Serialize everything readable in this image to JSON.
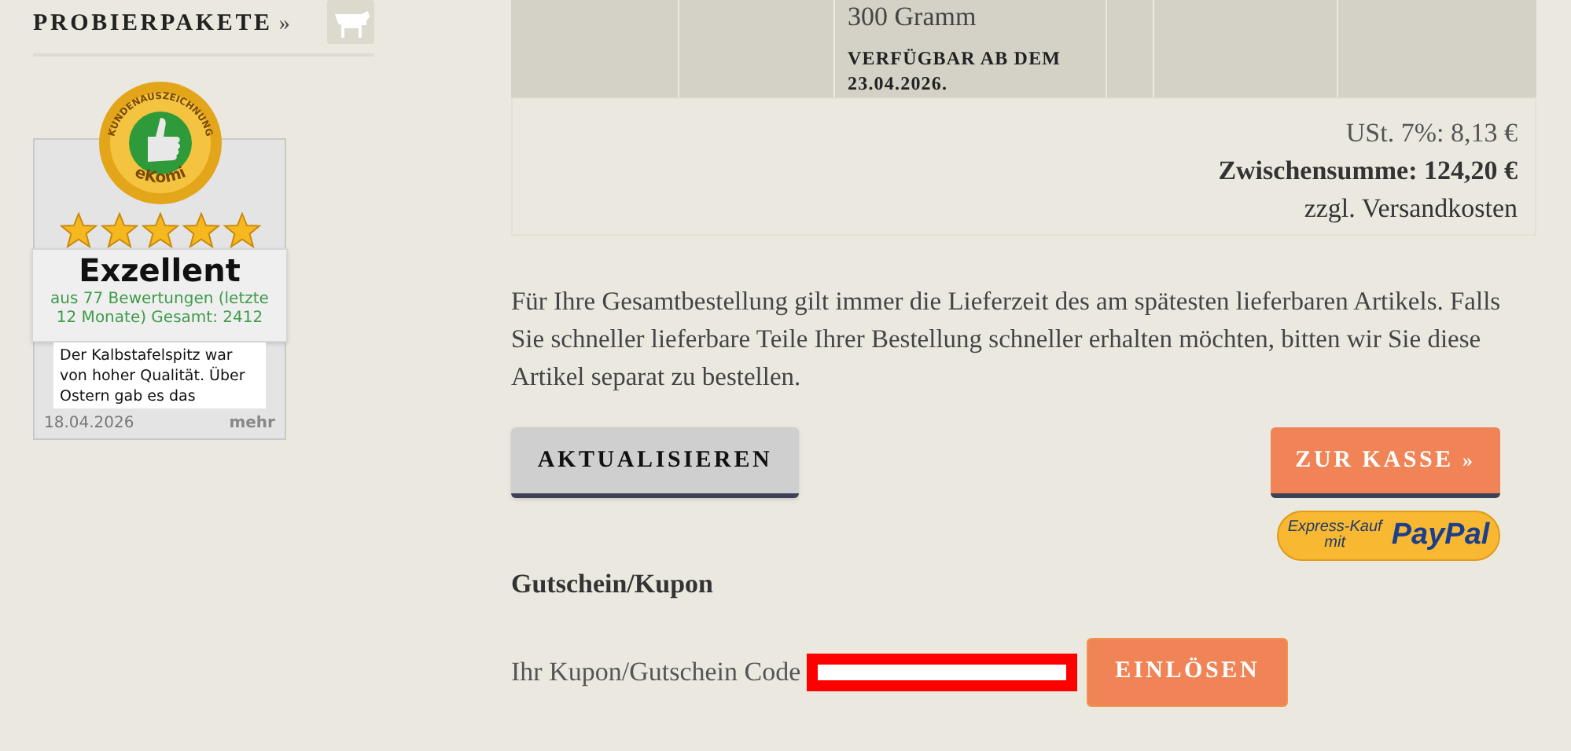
{
  "sidebar": {
    "title": "PROBIERPAKETE",
    "title_suffix": "»",
    "review_widget": {
      "seal_top": "KUNDENAUSZEICHNUNG",
      "seal_bottom": "eKomi",
      "stars": 5,
      "rating": "Exzellent",
      "summary": "aus 77 Bewertungen (letzte 12 Monate) Gesamt: 2412",
      "review": "Der Kalbstafelspitz war von hoher Qualität. Über Ostern gab es das",
      "date": "18.04.2026",
      "more": "mehr"
    }
  },
  "cart_row": {
    "cells": [
      {
        "kind": "empty"
      },
      {
        "kind": "empty"
      },
      {
        "kind": "product",
        "amount": "300 Gramm",
        "availability": "VERFÜGBAR AB DEM 23.04.2026."
      },
      {
        "kind": "empty"
      },
      {
        "kind": "empty"
      },
      {
        "kind": "empty"
      }
    ]
  },
  "totals": {
    "tax": "USt. 7%: 8,13 €",
    "subtotal": "Zwischensumme: 124,20 €",
    "shipping": "zzgl. Versandkosten"
  },
  "delivery_note": "Für Ihre Gesamtbestellung gilt immer die Lieferzeit des am spätesten lieferbaren Artikels. Falls Sie schneller lieferbare Teile Ihrer Bestellung schneller erhalten möchten, bitten wir Sie diese Artikel separat zu bestellen.",
  "update_button": "AKTUALISIEREN",
  "checkout_button": {
    "label": "ZUR KASSE",
    "suffix": "»"
  },
  "paypal_button": {
    "line1": "Express-Kauf",
    "line2": "mit",
    "brand": "PayPal"
  },
  "coupon": {
    "heading": "Gutschein/Kupon",
    "label": "Ihr Kupon/Gutschein Code",
    "button": "EINLÖSEN"
  }
}
